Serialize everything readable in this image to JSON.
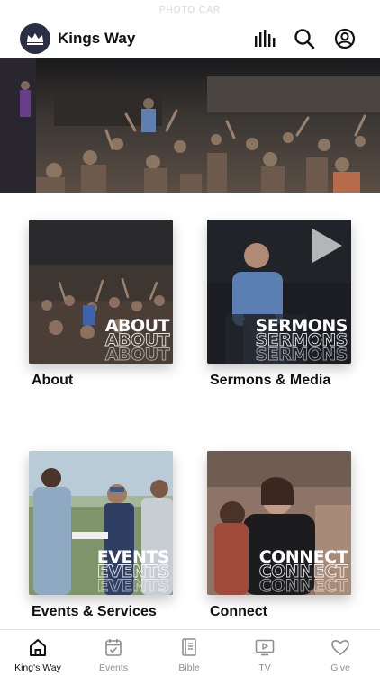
{
  "status": {
    "text": "PHOTO CAR"
  },
  "header": {
    "title": "Kings Way",
    "icons": [
      "bars-icon",
      "search-icon",
      "profile-icon"
    ]
  },
  "hero": {
    "alt_icon": "worship-photo"
  },
  "cards": [
    {
      "overlay": "ABOUT",
      "label": "About"
    },
    {
      "overlay": "SERMONS",
      "label": "Sermons & Media"
    },
    {
      "overlay": "EVENTS",
      "label": "Events & Services"
    },
    {
      "overlay": "CONNECT",
      "label": "Connect"
    }
  ],
  "tabs": [
    {
      "label": "King's Way",
      "icon": "home-icon",
      "active": true
    },
    {
      "label": "Events",
      "icon": "calendar-icon",
      "active": false
    },
    {
      "label": "Bible",
      "icon": "book-icon",
      "active": false
    },
    {
      "label": "TV",
      "icon": "tv-icon",
      "active": false
    },
    {
      "label": "Give",
      "icon": "heart-icon",
      "active": false
    }
  ],
  "colors": {
    "accent": "#111111",
    "inactive": "#8e8e8e",
    "logo_bg": "#2a2f45"
  }
}
